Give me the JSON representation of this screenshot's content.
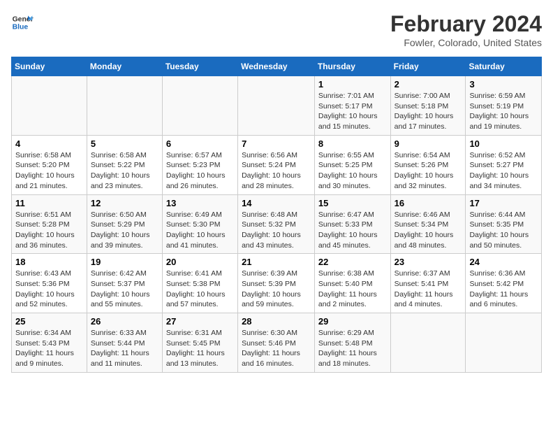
{
  "logo": {
    "text_general": "General",
    "text_blue": "Blue"
  },
  "header": {
    "title": "February 2024",
    "subtitle": "Fowler, Colorado, United States"
  },
  "weekdays": [
    "Sunday",
    "Monday",
    "Tuesday",
    "Wednesday",
    "Thursday",
    "Friday",
    "Saturday"
  ],
  "weeks": [
    [
      {
        "day": "",
        "info": ""
      },
      {
        "day": "",
        "info": ""
      },
      {
        "day": "",
        "info": ""
      },
      {
        "day": "",
        "info": ""
      },
      {
        "day": "1",
        "info": "Sunrise: 7:01 AM\nSunset: 5:17 PM\nDaylight: 10 hours\nand 15 minutes."
      },
      {
        "day": "2",
        "info": "Sunrise: 7:00 AM\nSunset: 5:18 PM\nDaylight: 10 hours\nand 17 minutes."
      },
      {
        "day": "3",
        "info": "Sunrise: 6:59 AM\nSunset: 5:19 PM\nDaylight: 10 hours\nand 19 minutes."
      }
    ],
    [
      {
        "day": "4",
        "info": "Sunrise: 6:58 AM\nSunset: 5:20 PM\nDaylight: 10 hours\nand 21 minutes."
      },
      {
        "day": "5",
        "info": "Sunrise: 6:58 AM\nSunset: 5:22 PM\nDaylight: 10 hours\nand 23 minutes."
      },
      {
        "day": "6",
        "info": "Sunrise: 6:57 AM\nSunset: 5:23 PM\nDaylight: 10 hours\nand 26 minutes."
      },
      {
        "day": "7",
        "info": "Sunrise: 6:56 AM\nSunset: 5:24 PM\nDaylight: 10 hours\nand 28 minutes."
      },
      {
        "day": "8",
        "info": "Sunrise: 6:55 AM\nSunset: 5:25 PM\nDaylight: 10 hours\nand 30 minutes."
      },
      {
        "day": "9",
        "info": "Sunrise: 6:54 AM\nSunset: 5:26 PM\nDaylight: 10 hours\nand 32 minutes."
      },
      {
        "day": "10",
        "info": "Sunrise: 6:52 AM\nSunset: 5:27 PM\nDaylight: 10 hours\nand 34 minutes."
      }
    ],
    [
      {
        "day": "11",
        "info": "Sunrise: 6:51 AM\nSunset: 5:28 PM\nDaylight: 10 hours\nand 36 minutes."
      },
      {
        "day": "12",
        "info": "Sunrise: 6:50 AM\nSunset: 5:29 PM\nDaylight: 10 hours\nand 39 minutes."
      },
      {
        "day": "13",
        "info": "Sunrise: 6:49 AM\nSunset: 5:30 PM\nDaylight: 10 hours\nand 41 minutes."
      },
      {
        "day": "14",
        "info": "Sunrise: 6:48 AM\nSunset: 5:32 PM\nDaylight: 10 hours\nand 43 minutes."
      },
      {
        "day": "15",
        "info": "Sunrise: 6:47 AM\nSunset: 5:33 PM\nDaylight: 10 hours\nand 45 minutes."
      },
      {
        "day": "16",
        "info": "Sunrise: 6:46 AM\nSunset: 5:34 PM\nDaylight: 10 hours\nand 48 minutes."
      },
      {
        "day": "17",
        "info": "Sunrise: 6:44 AM\nSunset: 5:35 PM\nDaylight: 10 hours\nand 50 minutes."
      }
    ],
    [
      {
        "day": "18",
        "info": "Sunrise: 6:43 AM\nSunset: 5:36 PM\nDaylight: 10 hours\nand 52 minutes."
      },
      {
        "day": "19",
        "info": "Sunrise: 6:42 AM\nSunset: 5:37 PM\nDaylight: 10 hours\nand 55 minutes."
      },
      {
        "day": "20",
        "info": "Sunrise: 6:41 AM\nSunset: 5:38 PM\nDaylight: 10 hours\nand 57 minutes."
      },
      {
        "day": "21",
        "info": "Sunrise: 6:39 AM\nSunset: 5:39 PM\nDaylight: 10 hours\nand 59 minutes."
      },
      {
        "day": "22",
        "info": "Sunrise: 6:38 AM\nSunset: 5:40 PM\nDaylight: 11 hours\nand 2 minutes."
      },
      {
        "day": "23",
        "info": "Sunrise: 6:37 AM\nSunset: 5:41 PM\nDaylight: 11 hours\nand 4 minutes."
      },
      {
        "day": "24",
        "info": "Sunrise: 6:36 AM\nSunset: 5:42 PM\nDaylight: 11 hours\nand 6 minutes."
      }
    ],
    [
      {
        "day": "25",
        "info": "Sunrise: 6:34 AM\nSunset: 5:43 PM\nDaylight: 11 hours\nand 9 minutes."
      },
      {
        "day": "26",
        "info": "Sunrise: 6:33 AM\nSunset: 5:44 PM\nDaylight: 11 hours\nand 11 minutes."
      },
      {
        "day": "27",
        "info": "Sunrise: 6:31 AM\nSunset: 5:45 PM\nDaylight: 11 hours\nand 13 minutes."
      },
      {
        "day": "28",
        "info": "Sunrise: 6:30 AM\nSunset: 5:46 PM\nDaylight: 11 hours\nand 16 minutes."
      },
      {
        "day": "29",
        "info": "Sunrise: 6:29 AM\nSunset: 5:48 PM\nDaylight: 11 hours\nand 18 minutes."
      },
      {
        "day": "",
        "info": ""
      },
      {
        "day": "",
        "info": ""
      }
    ]
  ]
}
